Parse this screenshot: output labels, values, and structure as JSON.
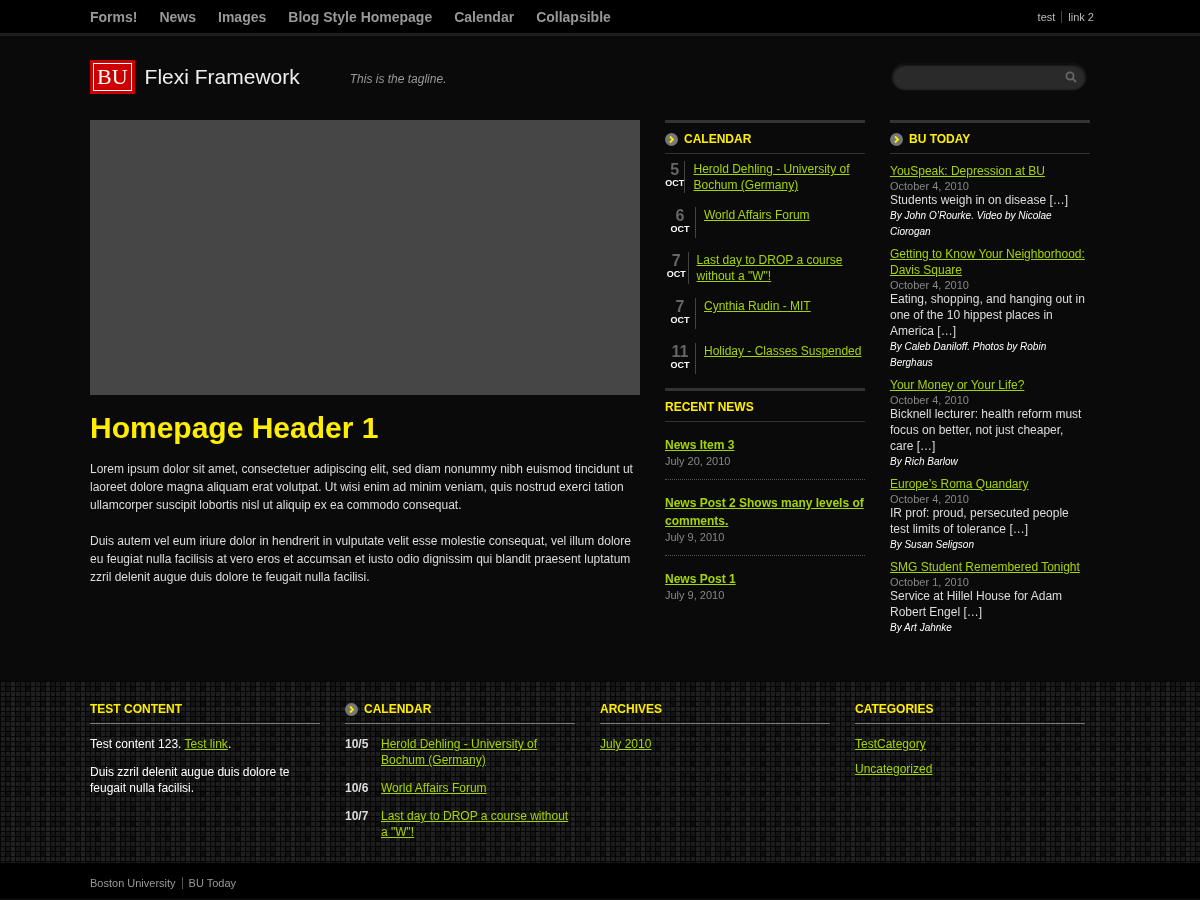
{
  "top_nav": {
    "items": [
      "Forms!",
      "News",
      "Images",
      "Blog Style Homepage",
      "Calendar",
      "Collapsible"
    ],
    "utility_links": [
      "test",
      "link 2"
    ]
  },
  "header": {
    "logo_mark": "BU",
    "site_name": "Flexi Framework",
    "tagline": "This is the tagline."
  },
  "main": {
    "title": "Homepage Header 1",
    "paragraphs": [
      "Lorem ipsum dolor sit amet, consectetuer adipiscing elit, sed diam nonummy nibh euismod tincidunt ut laoreet dolore magna aliquam erat volutpat. Ut wisi enim ad minim veniam, quis nostrud exerci tation ullamcorper suscipit lobortis nisl ut aliquip ex ea commodo consequat.",
      "Duis autem vel eum iriure dolor in hendrerit in vulputate velit esse molestie consequat, vel illum dolore eu feugiat nulla facilisis at vero eros et accumsan et iusto odio dignissim qui blandit praesent luptatum zzril delenit augue duis dolore te feugait nulla facilisi."
    ]
  },
  "calendar": {
    "title": "CALENDAR",
    "events": [
      {
        "day": "5",
        "month": "OCT",
        "title": "Herold Dehling - University of Bochum (Germany)"
      },
      {
        "day": "6",
        "month": "OCT",
        "title": "World Affairs Forum"
      },
      {
        "day": "7",
        "month": "OCT",
        "title": "Last day to DROP a course without a \"W\"!"
      },
      {
        "day": "7",
        "month": "OCT",
        "title": "Cynthia Rudin - MIT"
      },
      {
        "day": "11",
        "month": "OCT",
        "title": "Holiday - Classes Suspended"
      }
    ]
  },
  "recent_news": {
    "title": "RECENT NEWS",
    "items": [
      {
        "title": "News Item 3",
        "date": "July 20, 2010"
      },
      {
        "title": "News Post 2 Shows many levels of comments.",
        "date": "July 9, 2010"
      },
      {
        "title": "News Post 1",
        "date": "July 9, 2010"
      }
    ]
  },
  "bu_today": {
    "title": "BU TODAY",
    "stories": [
      {
        "title": "YouSpeak: Depression at BU",
        "date": "October 4, 2010",
        "summary": "Students weigh in on disease […]",
        "byline": "By John O’Rourke. Video by Nicolae Ciorogan"
      },
      {
        "title": "Getting to Know Your Neighborhood: Davis Square",
        "date": "October 4, 2010",
        "summary": "Eating, shopping, and hanging out in one of the 10 hippest places in America […]",
        "byline": "By Caleb Daniloff. Photos by Robin Berghaus"
      },
      {
        "title": "Your Money or Your Life?",
        "date": "October 4, 2010",
        "summary": "Bicknell lecturer: health reform must focus on better, not just cheaper, care […]",
        "byline": "By Rich Barlow"
      },
      {
        "title": "Europe’s Roma Quandary",
        "date": "October 4, 2010",
        "summary": "IR prof: proud, persecuted people test limits of tolerance […]",
        "byline": "By Susan Seligson"
      },
      {
        "title": "SMG Student Remembered Tonight",
        "date": "October 1, 2010",
        "summary": "Service at Hillel House for Adam Robert Engel […]",
        "byline": "By Art Jahnke"
      }
    ]
  },
  "footer_widgets": {
    "test_content": {
      "title": "TEST CONTENT",
      "text": "Test content 123.",
      "link": "Test link",
      "after_link": ".",
      "paragraph": "Duis zzril delenit augue duis dolore te feugait nulla facilisi."
    },
    "calendar": {
      "title": "CALENDAR",
      "events": [
        {
          "date": "10/5",
          "title": "Herold Dehling - University of Bochum (Germany)"
        },
        {
          "date": "10/6",
          "title": "World Affairs Forum"
        },
        {
          "date": "10/7",
          "title": "Last day to DROP a course without a \"W\"!"
        }
      ]
    },
    "archives": {
      "title": "ARCHIVES",
      "links": [
        "July 2010"
      ]
    },
    "categories": {
      "title": "CATEGORIES",
      "links": [
        "TestCategory",
        "Uncategorized"
      ]
    }
  },
  "footer": {
    "links": [
      "Boston University",
      "BU Today"
    ]
  }
}
